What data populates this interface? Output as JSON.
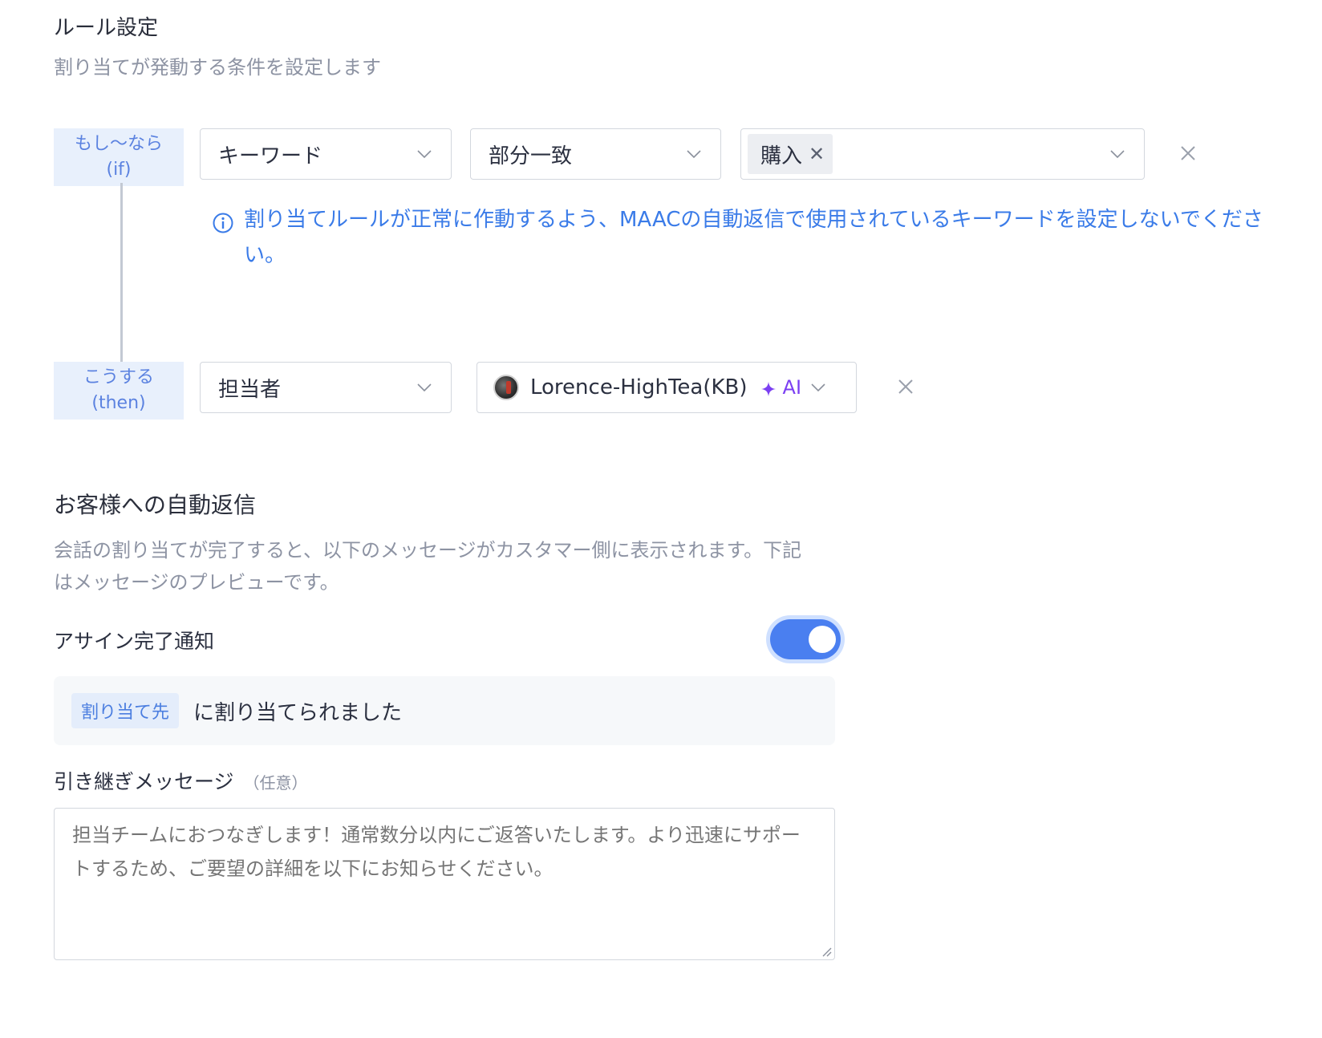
{
  "rule_settings": {
    "title": "ルール設定",
    "description": "割り当てが発動する条件を設定します"
  },
  "if_block": {
    "label_line1": "もし〜なら",
    "label_line2": "(if)",
    "condition_select": "キーワード",
    "match_select": "部分一致",
    "keyword_tag": "購入",
    "info_text": "割り当てルールが正常に作動するよう、MAACの自動返信で使用されているキーワードを設定しないでください。"
  },
  "then_block": {
    "label_line1": "こうする",
    "label_line2": "(then)",
    "action_select": "担当者",
    "assignee_name": "Lorence-HighTea(KB)",
    "assignee_badge": "AI"
  },
  "auto_reply": {
    "title": "お客様への自動返信",
    "description": "会話の割り当てが完了すると、以下のメッセージがカスタマー側に表示されます。下記はメッセージのプレビューです。",
    "notify_label": "アサイン完了通知",
    "notify_enabled": true,
    "preview_variable": "割り当て先",
    "preview_text": "に割り当てられました",
    "handover_label": "引き継ぎメッセージ",
    "handover_optional": "（任意）",
    "handover_placeholder": "担当チームにおつなぎします！通常数分以内にご返答いたします。より迅速にサポートするため、ご要望の詳細を以下にお知らせください。"
  },
  "colors": {
    "accent": "#4a7ff0",
    "info_blue": "#3a7be8",
    "ai_purple": "#7b3ff2",
    "label_bg": "#e8f0fc"
  },
  "icons": [
    "chevron-down-icon",
    "close-icon",
    "info-icon",
    "sparkle-icon",
    "resize-grip-icon"
  ]
}
